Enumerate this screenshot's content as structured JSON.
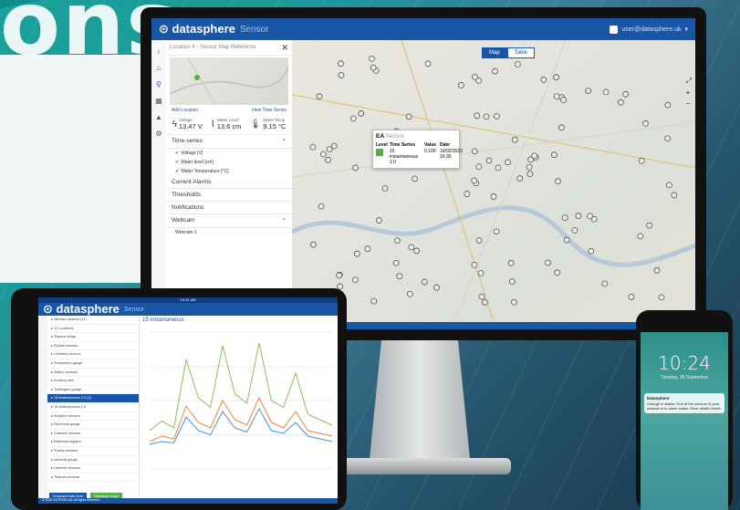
{
  "colors": {
    "brand": "#1a56a6",
    "ok": "#56b046",
    "accent": "#d07a2e",
    "teal": "#2e8f8a"
  },
  "headline": "ons",
  "monitor": {
    "brand": "datasphere",
    "product": "Sensor",
    "user": "user@datasphere.uk",
    "panel": {
      "title": "Location 4 - Sensor Map Reference",
      "add_location": "Add Location",
      "view_timeseries": "View Time Series",
      "readings": [
        {
          "icon": "bolt-icon",
          "label": "Voltage",
          "value": "13.47 V"
        },
        {
          "icon": "water-level-icon",
          "label": "Water Level",
          "value": "13.6 cm"
        },
        {
          "icon": "thermometer-icon",
          "label": "Water Temp",
          "value": "9.15 °C"
        }
      ],
      "sections": [
        "Time-series",
        "Current Alarms",
        "Thresholds",
        "Notifications",
        "Webcam"
      ],
      "timeseries": [
        "Voltage [V]",
        "Water level [cm]",
        "Water Temperature [°C]"
      ],
      "webcam_item": "Webcam 1"
    },
    "map": {
      "toggle": [
        "Map",
        "Table"
      ],
      "popup": {
        "title": "EA",
        "subtitle": "Sensor",
        "headers": [
          "Level",
          "Time Series",
          "Value",
          "Date"
        ],
        "row": {
          "series": "15 instantaneous 2.0",
          "value": "0.100",
          "date": "16/02/2022 16:30"
        }
      },
      "status": "All times in page are UTC+0"
    }
  },
  "tablet": {
    "status": "10:21 AM",
    "brand": "datasphere",
    "product": "Sensor",
    "chart_title": "15 instantaneous",
    "tree": [
      "Windsor sensors (11)",
      "10 Locations",
      "Staines bridge",
      "Egham sensors",
      "Chertsey sensors",
      "Shepperton gauge",
      "Walton sensors",
      "Sunbury weir",
      "Teddington gauge",
      "15 instantaneous 2.0 (2)",
      "15 instantaneous 2.5",
      "Kingston sensors",
      "Richmond gauge",
      "Chiswick sensors",
      "Battersea loggers",
      "Putney sensors",
      "Vauxhall gauge",
      "Lambeth sensors",
      "Thames sensors"
    ],
    "selected_index": 9,
    "buttons": [
      "Download Data Chart",
      "Download Graph"
    ],
    "footer": "© 2022 SUTRON Ltd. All rights reserved"
  },
  "phone": {
    "time": "10:24",
    "date": "Tuesday, 26 September",
    "notification": {
      "app": "Datasphere",
      "body": "Change in status. One of the sensors in your network is in alarm status. More details inside."
    }
  },
  "chart_data": {
    "type": "line",
    "series": [
      {
        "color": "#8cbf5a",
        "values": [
          28,
          35,
          30,
          80,
          52,
          45,
          90,
          55,
          48,
          92,
          50,
          45,
          70,
          40,
          36,
          32
        ]
      },
      {
        "color": "#e8873a",
        "values": [
          20,
          24,
          22,
          46,
          34,
          30,
          50,
          36,
          32,
          52,
          34,
          30,
          42,
          28,
          26,
          24
        ]
      },
      {
        "color": "#4a8fd8",
        "values": [
          18,
          20,
          19,
          38,
          28,
          25,
          42,
          30,
          27,
          44,
          28,
          26,
          34,
          24,
          22,
          20
        ]
      }
    ],
    "ylim": [
      0,
      100
    ]
  }
}
